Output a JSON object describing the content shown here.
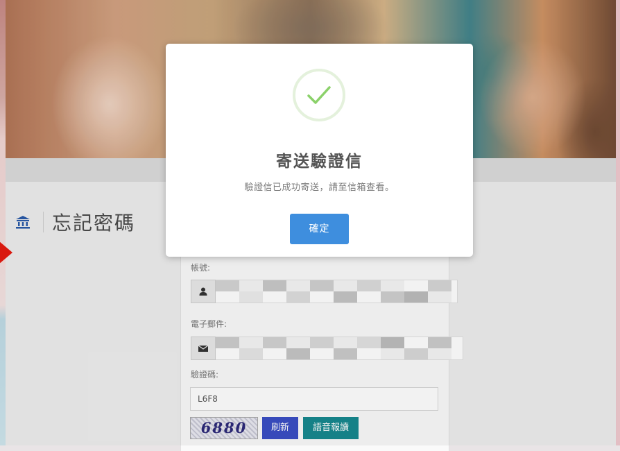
{
  "page": {
    "title": "忘記密碼"
  },
  "form": {
    "account_label": "帳號:",
    "email_label": "電子郵件:",
    "captcha_label": "驗證碼:",
    "captcha_value": "L6F8",
    "captcha_image_text": "6880",
    "refresh_label": "刷新",
    "audio_label": "語音報讀"
  },
  "dialog": {
    "title": "寄送驗證信",
    "message": "驗證信已成功寄送，請至信箱查看。",
    "confirm_label": "確定",
    "icon": "checkmark-icon"
  },
  "colors": {
    "accent": "#3e8ede",
    "success": "#8bd16a",
    "refresh_button": "#3a4fc4",
    "audio_button": "#17888f",
    "marker": "#e51b10"
  }
}
